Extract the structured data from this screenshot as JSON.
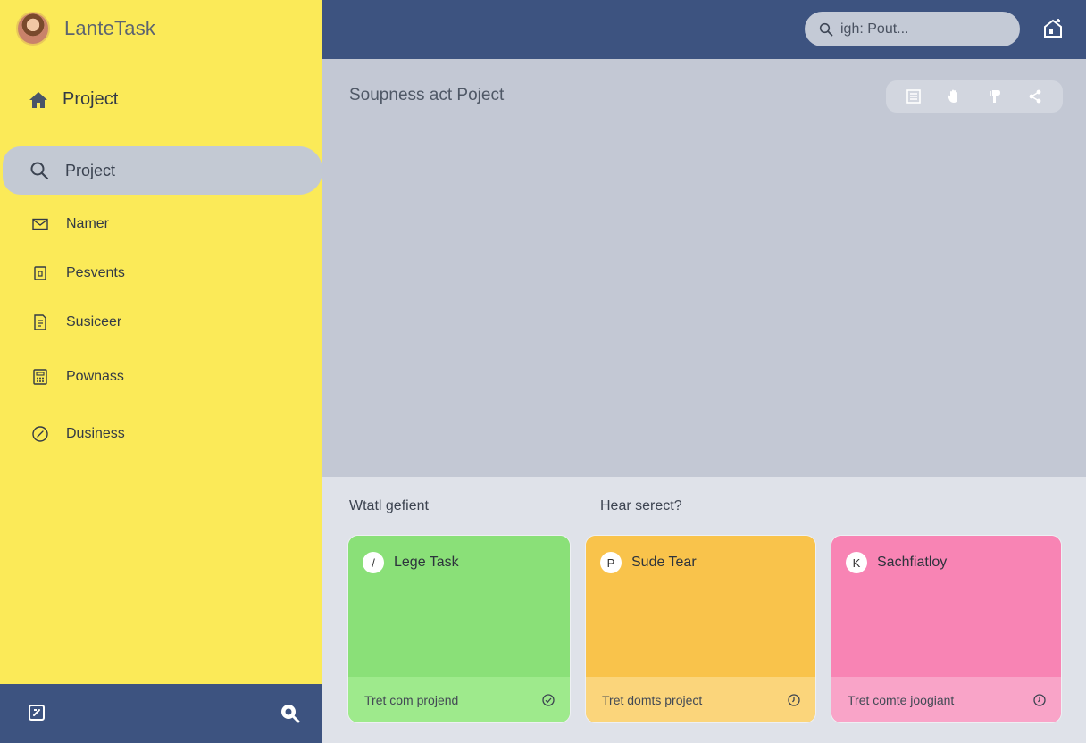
{
  "app": {
    "name": "LanteTask"
  },
  "sidebar": {
    "home_label": "Project",
    "items": [
      {
        "label": "Project",
        "icon": "search-icon",
        "active": true
      },
      {
        "label": "Namer",
        "icon": "mail-icon"
      },
      {
        "label": "Pesvents",
        "icon": "document-icon"
      },
      {
        "label": "Susiceer",
        "icon": "notes-icon"
      },
      {
        "label": "Pownass",
        "icon": "calculator-icon"
      },
      {
        "label": "Dusiness",
        "icon": "clock-icon"
      }
    ]
  },
  "header": {
    "search_placeholder": "igh: Pout..."
  },
  "main": {
    "title": "Soupness act Poject"
  },
  "lower": {
    "label_left": "Wtatl gefient",
    "label_right": "Hear serect?",
    "cards": [
      {
        "badge": "/",
        "title": "Lege Task",
        "footer": "Tret com projend",
        "color": "#8ae078",
        "foot_color": "#9eea8c"
      },
      {
        "badge": "P",
        "title": "Sude Tear",
        "footer": "Trеt domts project",
        "color": "#f9c34b",
        "foot_color": "#fbd57b"
      },
      {
        "badge": "K",
        "title": "Sachfiatloy",
        "footer": "Tret comte joogiant",
        "color": "#f884b4",
        "foot_color": "#f9a4c8"
      }
    ]
  },
  "colors": {
    "sidebar": "#fbea58",
    "topbar": "#3d5380",
    "main": "#c3c8d4"
  }
}
